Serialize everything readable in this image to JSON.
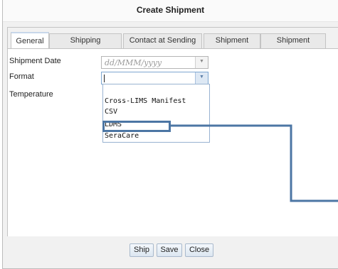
{
  "dialog": {
    "title": "Create Shipment"
  },
  "tabs": [
    {
      "label": "General"
    },
    {
      "label": "Shipping Destination"
    },
    {
      "label": "Contact at Sending Lab"
    },
    {
      "label": "Shipment Notes"
    },
    {
      "label": "Shipment Contents"
    }
  ],
  "active_tab": "General",
  "form": {
    "shipment_date": {
      "label": "Shipment Date",
      "placeholder": "dd/MMM/yyyy"
    },
    "format": {
      "label": "Format",
      "value": "",
      "options": [
        "Cross-LIMS Manifest",
        "CSV",
        "LDMS",
        "SeraCare"
      ],
      "highlighted_option": "LDMS"
    },
    "temperature": {
      "label": "Temperature"
    }
  },
  "buttons": {
    "ship": "Ship",
    "save": "Save",
    "close": "Close"
  },
  "colors": {
    "callout": "#4c76a4",
    "active_tab_accent": "#c7d7ea"
  }
}
